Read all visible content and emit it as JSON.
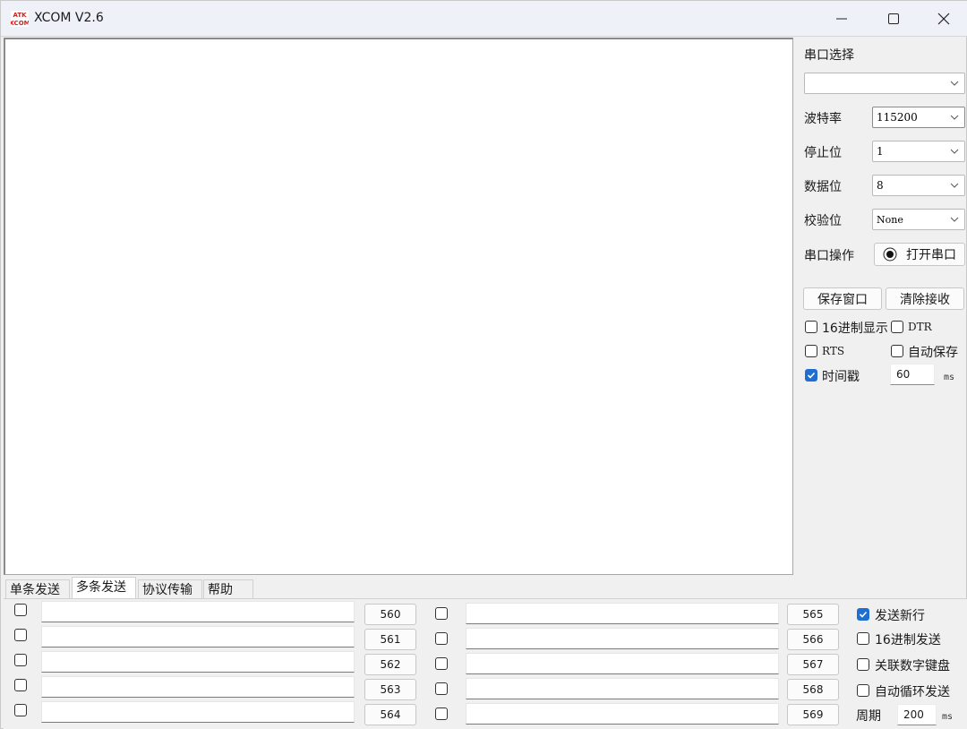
{
  "window": {
    "title": "XCOM V2.6"
  },
  "serial_config": {
    "port_label": "串口选择",
    "port_value": "",
    "baud_label": "波特率",
    "baud_value": "115200",
    "stop_label": "停止位",
    "stop_value": "1",
    "data_label": "数据位",
    "data_value": "8",
    "parity_label": "校验位",
    "parity_value": "None",
    "operation_label": "串口操作",
    "open_button": "打开串口"
  },
  "receive_options": {
    "save_window_button": "保存窗口",
    "clear_receive_button": "清除接收",
    "hex_display": {
      "label": "16进制显示",
      "checked": false
    },
    "dtr": {
      "label": "DTR",
      "checked": false
    },
    "rts": {
      "label": "RTS",
      "checked": false
    },
    "auto_save": {
      "label": "自动保存",
      "checked": false
    },
    "timestamp": {
      "label": "时间戳",
      "checked": true,
      "value": "60",
      "unit": "ms"
    }
  },
  "tabs": [
    "单条发送",
    "多条发送",
    "协议传输",
    "帮助"
  ],
  "active_tab": "多条发送",
  "multi_send": {
    "left_buttons": [
      "560",
      "561",
      "562",
      "563",
      "564"
    ],
    "right_buttons": [
      "565",
      "566",
      "567",
      "568",
      "569"
    ]
  },
  "send_options": {
    "newline": {
      "label": "发送新行",
      "checked": true
    },
    "hex_send": {
      "label": "16进制发送",
      "checked": false
    },
    "numpad": {
      "label": "关联数字键盘",
      "checked": false
    },
    "auto_loop": {
      "label": "自动循环发送",
      "checked": false
    },
    "period_label": "周期",
    "period_value": "200",
    "period_unit": "ms"
  },
  "colors": {
    "accent": "#1f6fd1",
    "titlebar": "#eef2f8",
    "panel": "#f0f0f0"
  },
  "icons": [
    "xcom-app-icon",
    "minimize-icon",
    "maximize-icon",
    "close-icon",
    "chevron-down-icon",
    "radio-indicator-icon",
    "checkmark-icon"
  ]
}
